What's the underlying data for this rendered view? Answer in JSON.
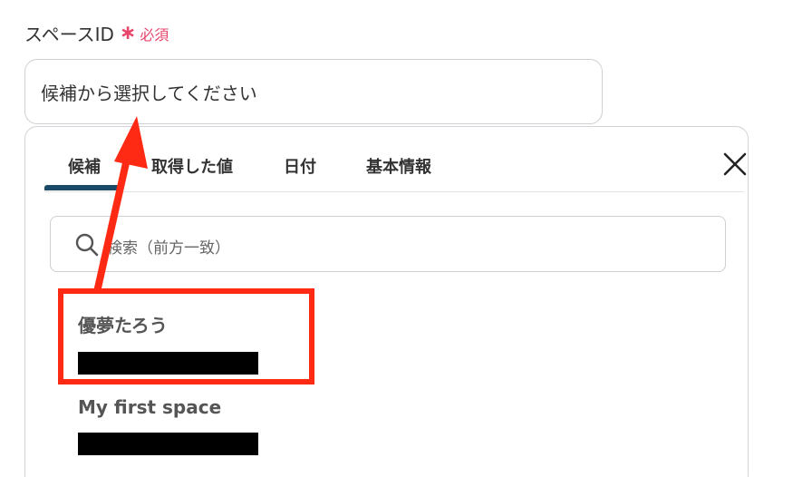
{
  "field": {
    "label": "スペースID",
    "required_star": "∗",
    "required_text": "必須"
  },
  "select": {
    "placeholder": "候補から選択してください"
  },
  "panel": {
    "tabs": [
      {
        "label": "候補",
        "active": true
      },
      {
        "label": "取得した値",
        "active": false
      },
      {
        "label": "日付",
        "active": false
      },
      {
        "label": "基本情報",
        "active": false
      }
    ],
    "close_icon": "close-icon",
    "active_tab_color": "#1b4a68"
  },
  "search": {
    "placeholder": "検索（前方一致）",
    "icon": "search-icon"
  },
  "options": [
    {
      "name": "優夢たろう",
      "redacted": true
    },
    {
      "name": "My first space",
      "redacted": true
    }
  ],
  "annotation": {
    "highlight_color": "#ff2a13",
    "arrow_color": "#ff2a13"
  },
  "colors": {
    "required": "#e8456b",
    "border": "#cfcfd4"
  }
}
